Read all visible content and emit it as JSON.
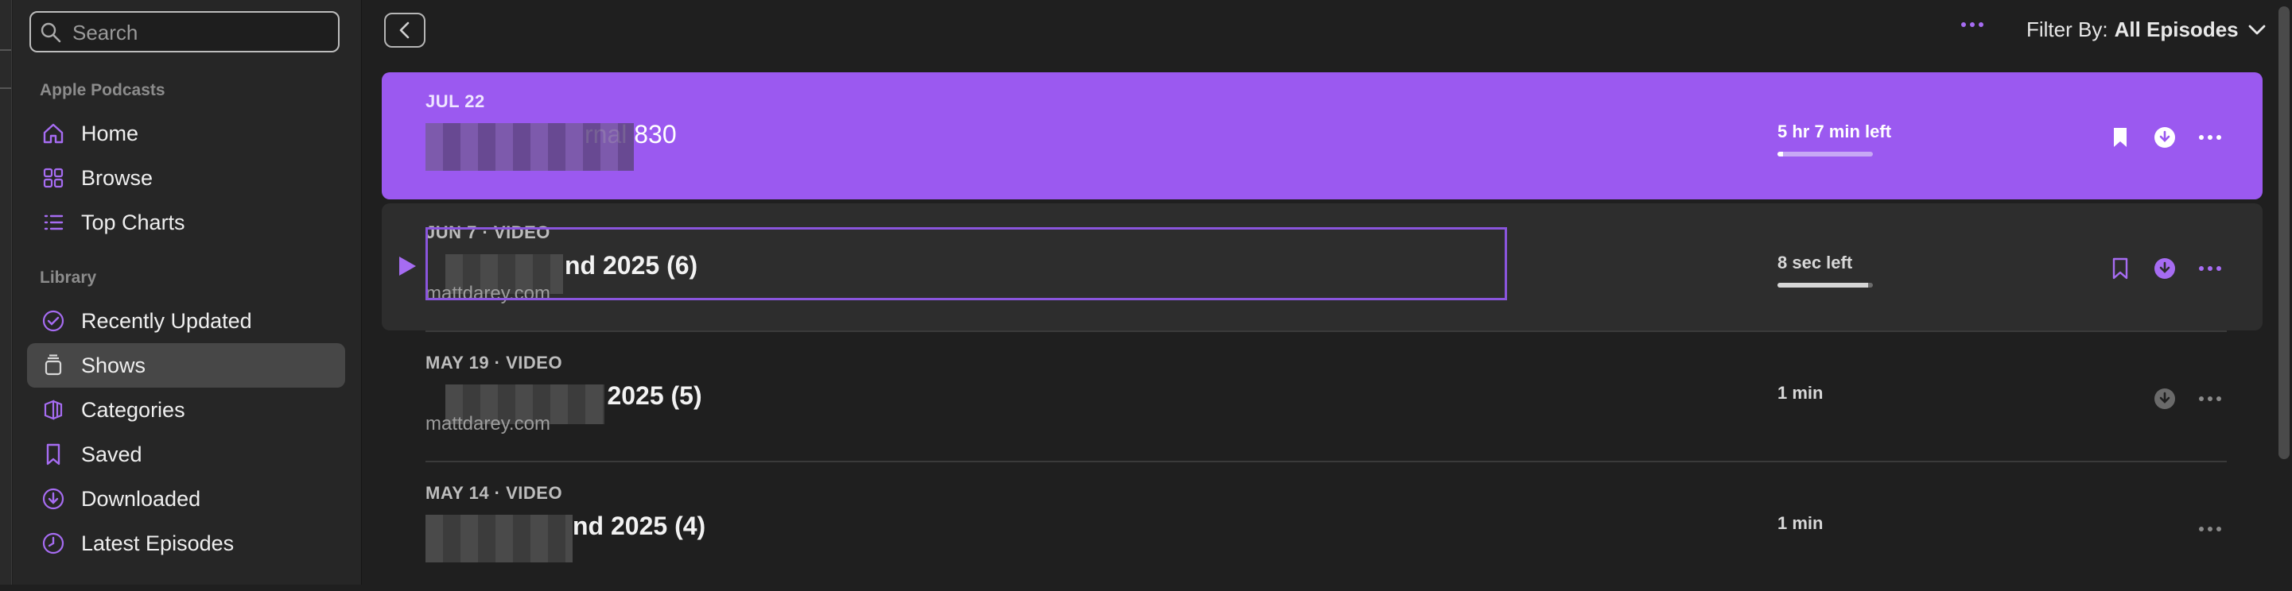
{
  "sidebar": {
    "search_placeholder": "Search",
    "section_apple": "Apple Podcasts",
    "section_library": "Library",
    "items": [
      {
        "label": "Home",
        "icon": "house-icon"
      },
      {
        "label": "Browse",
        "icon": "grid-icon"
      },
      {
        "label": "Top Charts",
        "icon": "list-icon"
      },
      {
        "label": "Recently Updated",
        "icon": "checkmark-circle-icon"
      },
      {
        "label": "Shows",
        "icon": "stack-icon",
        "selected": true
      },
      {
        "label": "Categories",
        "icon": "categories-icon"
      },
      {
        "label": "Saved",
        "icon": "bookmark-icon"
      },
      {
        "label": "Downloaded",
        "icon": "download-circle-icon"
      },
      {
        "label": "Latest Episodes",
        "icon": "clock-icon"
      }
    ]
  },
  "header": {
    "filter_prefix": "Filter By:",
    "filter_value": "All Episodes"
  },
  "episodes": [
    {
      "meta": "JUL 22",
      "title": "rnal 830",
      "subtitle": "",
      "time": "5 hr 7 min left",
      "progress": 0.06,
      "state": "playing"
    },
    {
      "meta": "JUN 7 · VIDEO",
      "title": "nd 2025 (6)",
      "subtitle": "mattdarey.com",
      "time": "8 sec left",
      "progress": 0.95,
      "state": "focused"
    },
    {
      "meta": "MAY 19 · VIDEO",
      "title": "d 2025 (5)",
      "subtitle": "mattdarey.com",
      "time": "1 min",
      "progress": null,
      "state": "normal"
    },
    {
      "meta": "MAY 14 · VIDEO",
      "title": "nd 2025 (4)",
      "subtitle": "",
      "time": "1 min",
      "progress": null,
      "state": "normal"
    }
  ],
  "colors": {
    "accent": "#9b59f0",
    "sidebar_bg": "#262626",
    "main_bg": "#1f1f1f"
  }
}
